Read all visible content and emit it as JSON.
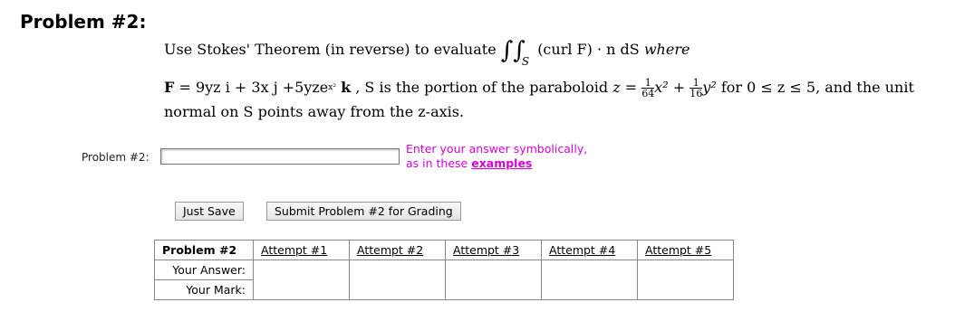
{
  "problem": {
    "title": "Problem #2:",
    "instruction": "Use Stokes' Theorem (in reverse) to evaluate",
    "integral_expr": "(curl F) · n dS",
    "where": "where",
    "surface_symbol": "S",
    "field_prefix": "F",
    "equals": "=",
    "field_i": "9yz i",
    "field_j": "3x j",
    "field_k_coeff": "5yze",
    "field_k_exp": "x²",
    "k_vec": "k",
    "surface_text": ", S is the portion of the paraboloid",
    "z_eq": "z =",
    "frac1_num": "1",
    "frac1_den": "64",
    "x2": "x²",
    "plus": "+",
    "frac2_num": "1",
    "frac2_den": "16",
    "y2": "y²",
    "range_text": "for 0 ≤ z ≤ 5, and the unit",
    "line3": "normal on S points away from the z-axis."
  },
  "answer": {
    "label": "Problem #2:",
    "value": "",
    "hint_line1": "Enter your answer symbolically,",
    "hint_line2_prefix": "as in these",
    "hint_link": "examples"
  },
  "buttons": {
    "save": "Just Save",
    "submit": "Submit Problem #2 for Grading"
  },
  "attempts_table": {
    "header": "Problem #2",
    "attempts": [
      "Attempt #1",
      "Attempt #2",
      "Attempt #3",
      "Attempt #4",
      "Attempt #5"
    ],
    "row_answer": "Your Answer:",
    "row_mark": "Your Mark:"
  }
}
